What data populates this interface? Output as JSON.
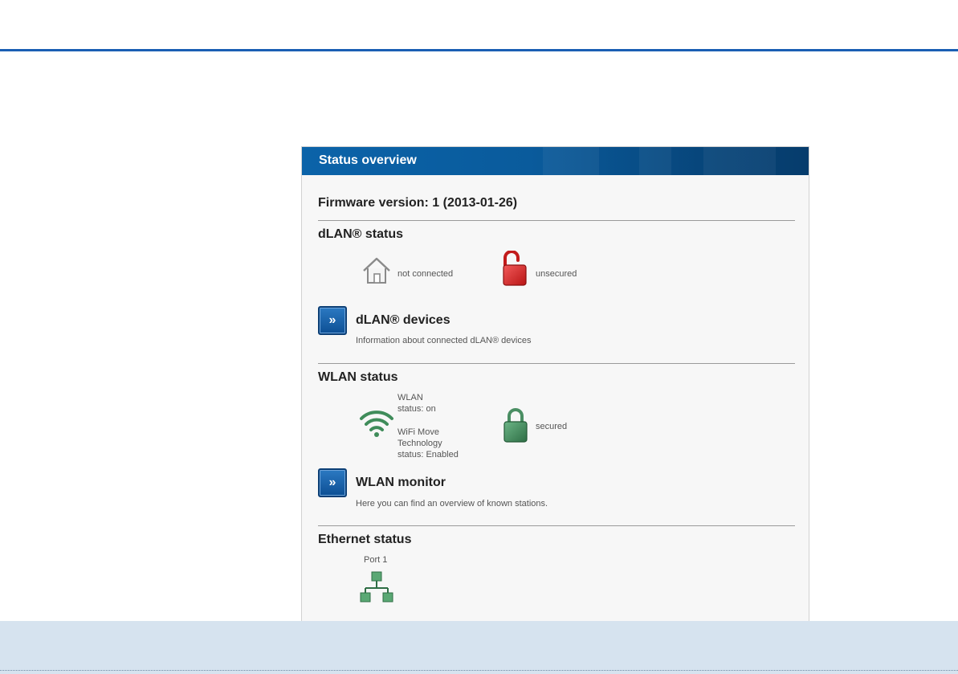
{
  "panel": {
    "title": "Status overview",
    "firmware": "Firmware version: 1 (2013-01-26)"
  },
  "dlan": {
    "section_title": "dLAN® status",
    "connection_status": "not connected",
    "security_status": "unsecured",
    "devices_link": {
      "label": "dLAN® devices",
      "description": "Information about connected dLAN® devices"
    }
  },
  "wlan": {
    "section_title": "WLAN status",
    "status_line1": "WLAN",
    "status_line2": "status: on",
    "wifimove_line1": "WiFi Move",
    "wifimove_line2": "Technology",
    "wifimove_line3": "status: Enabled",
    "security_status": "secured",
    "monitor_link": {
      "label": "WLAN monitor",
      "description": "Here you can find an overview of known stations."
    }
  },
  "ethernet": {
    "section_title": "Ethernet status",
    "port_label": "Port 1"
  },
  "colors": {
    "accent_blue": "#1a5fb4",
    "header_blue": "#0b63a9",
    "unsecured_red": "#d42020",
    "secured_green": "#3f8c5a",
    "footer_band": "#d6e3ef"
  },
  "icons": {
    "home": "home-icon",
    "lock_open": "lock-open-icon",
    "lock_closed": "lock-closed-icon",
    "wifi": "wifi-icon",
    "network": "network-icon",
    "chevron": "double-chevron-right-icon"
  }
}
